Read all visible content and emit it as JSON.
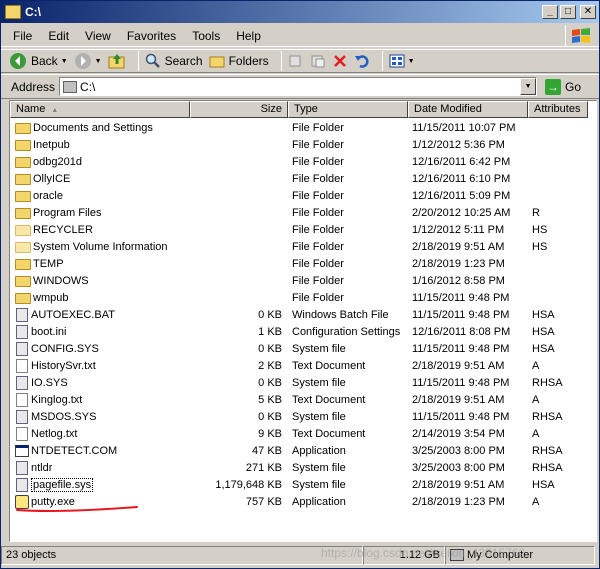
{
  "window": {
    "title": "C:\\"
  },
  "menu": [
    "File",
    "Edit",
    "View",
    "Favorites",
    "Tools",
    "Help"
  ],
  "toolbar": {
    "back": "Back",
    "search": "Search",
    "folders": "Folders"
  },
  "address": {
    "label": "Address",
    "value": "C:\\",
    "go": "Go"
  },
  "columns": {
    "name": "Name",
    "size": "Size",
    "type": "Type",
    "date": "Date Modified",
    "attr": "Attributes"
  },
  "files": [
    {
      "name": "Documents and Settings",
      "size": "",
      "type": "File Folder",
      "date": "11/15/2011 10:07 PM",
      "attr": "",
      "icon": "folder"
    },
    {
      "name": "Inetpub",
      "size": "",
      "type": "File Folder",
      "date": "1/12/2012 5:36 PM",
      "attr": "",
      "icon": "folder"
    },
    {
      "name": "odbg201d",
      "size": "",
      "type": "File Folder",
      "date": "12/16/2011 6:42 PM",
      "attr": "",
      "icon": "folder"
    },
    {
      "name": "OllyICE",
      "size": "",
      "type": "File Folder",
      "date": "12/16/2011 6:10 PM",
      "attr": "",
      "icon": "folder"
    },
    {
      "name": "oracle",
      "size": "",
      "type": "File Folder",
      "date": "12/16/2011 5:09 PM",
      "attr": "",
      "icon": "folder"
    },
    {
      "name": "Program Files",
      "size": "",
      "type": "File Folder",
      "date": "2/20/2012 10:25 AM",
      "attr": "R",
      "icon": "folder"
    },
    {
      "name": "RECYCLER",
      "size": "",
      "type": "File Folder",
      "date": "1/12/2012 5:11 PM",
      "attr": "HS",
      "icon": "folder-faded"
    },
    {
      "name": "System Volume Information",
      "size": "",
      "type": "File Folder",
      "date": "2/18/2019 9:51 AM",
      "attr": "HS",
      "icon": "folder-faded"
    },
    {
      "name": "TEMP",
      "size": "",
      "type": "File Folder",
      "date": "2/18/2019 1:23 PM",
      "attr": "",
      "icon": "folder"
    },
    {
      "name": "WINDOWS",
      "size": "",
      "type": "File Folder",
      "date": "1/16/2012 8:58 PM",
      "attr": "",
      "icon": "folder"
    },
    {
      "name": "wmpub",
      "size": "",
      "type": "File Folder",
      "date": "11/15/2011 9:48 PM",
      "attr": "",
      "icon": "folder"
    },
    {
      "name": "AUTOEXEC.BAT",
      "size": "0 KB",
      "type": "Windows Batch File",
      "date": "11/15/2011 9:48 PM",
      "attr": "HSA",
      "icon": "sys"
    },
    {
      "name": "boot.ini",
      "size": "1 KB",
      "type": "Configuration Settings",
      "date": "12/16/2011 8:08 PM",
      "attr": "HSA",
      "icon": "sys"
    },
    {
      "name": "CONFIG.SYS",
      "size": "0 KB",
      "type": "System file",
      "date": "11/15/2011 9:48 PM",
      "attr": "HSA",
      "icon": "sys"
    },
    {
      "name": "HistorySvr.txt",
      "size": "2 KB",
      "type": "Text Document",
      "date": "2/18/2019 9:51 AM",
      "attr": "A",
      "icon": "file"
    },
    {
      "name": "IO.SYS",
      "size": "0 KB",
      "type": "System file",
      "date": "11/15/2011 9:48 PM",
      "attr": "RHSA",
      "icon": "sys"
    },
    {
      "name": "Kinglog.txt",
      "size": "5 KB",
      "type": "Text Document",
      "date": "2/18/2019 9:51 AM",
      "attr": "A",
      "icon": "file"
    },
    {
      "name": "MSDOS.SYS",
      "size": "0 KB",
      "type": "System file",
      "date": "11/15/2011 9:48 PM",
      "attr": "RHSA",
      "icon": "sys"
    },
    {
      "name": "Netlog.txt",
      "size": "9 KB",
      "type": "Text Document",
      "date": "2/14/2019 3:54 PM",
      "attr": "A",
      "icon": "file"
    },
    {
      "name": "NTDETECT.COM",
      "size": "47 KB",
      "type": "Application",
      "date": "3/25/2003 8:00 PM",
      "attr": "RHSA",
      "icon": "app"
    },
    {
      "name": "ntldr",
      "size": "271 KB",
      "type": "System file",
      "date": "3/25/2003 8:00 PM",
      "attr": "RHSA",
      "icon": "sys"
    },
    {
      "name": "pagefile.sys",
      "size": "1,179,648 KB",
      "type": "System file",
      "date": "2/18/2019 9:51 AM",
      "attr": "HSA",
      "icon": "sys",
      "focused": true
    },
    {
      "name": "putty.exe",
      "size": "757 KB",
      "type": "Application",
      "date": "2/18/2019 1:23 PM",
      "attr": "A",
      "icon": "putty"
    }
  ],
  "status": {
    "objects": "23 objects",
    "size": "1.12 GB",
    "location": "My Computer",
    "watermark": "https://blog.csdn.net/weixin_43915762"
  },
  "colors": {
    "titlebar_start": "#0a246a",
    "titlebar_end": "#a6caf0",
    "annotation": "#e8141b",
    "folder": "#f4d56c"
  }
}
